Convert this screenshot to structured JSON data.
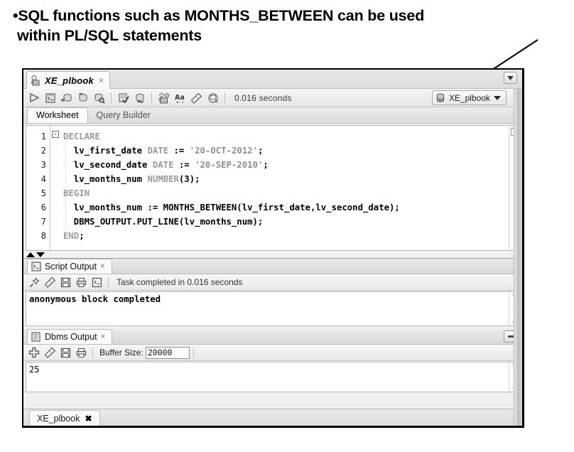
{
  "slide": {
    "bullet_marker": "•",
    "bullet_line1": "SQL functions such as MONTHS_BETWEEN can be used",
    "bullet_line2": "within PL/SQL statements",
    "annotation": "arrow-pointing-to-months-between-call"
  },
  "window": {
    "document_tab": {
      "label": "XE_plbook",
      "close": "×",
      "icon": "sql-worksheet-icon"
    },
    "collapse_button": "chevron-down-icon",
    "toolbar": {
      "buttons": [
        {
          "name": "run-statement-button",
          "icon": "play-triangle-icon"
        },
        {
          "name": "run-script-button",
          "icon": "script-page-icon"
        },
        {
          "name": "explain-plan-button",
          "icon": "explain-plan-icon"
        },
        {
          "name": "autotrace-button",
          "icon": "autotrace-icon"
        },
        {
          "name": "sql-history-button",
          "icon": "db-search-icon"
        },
        {
          "name": "commit-button",
          "icon": "db-check-icon"
        },
        {
          "name": "rollback-button",
          "icon": "db-rollback-icon"
        },
        {
          "name": "unshared-worksheet-button",
          "icon": "sql-new-icon"
        },
        {
          "name": "to-upper-lower-button",
          "icon": "Aa"
        },
        {
          "name": "clear-button",
          "icon": "eraser-icon"
        },
        {
          "name": "query-builder-button",
          "icon": "circle-arrow-icon"
        }
      ],
      "elapsed": "0.016 seconds",
      "connection": {
        "icon": "database-icon",
        "name": "XE_plbook",
        "caret": "chevron-down-icon"
      }
    },
    "worksheet_tabs": [
      {
        "label": "Worksheet",
        "active": true
      },
      {
        "label": "Query Builder",
        "active": false
      }
    ],
    "editor": {
      "line_numbers": [
        "1",
        "2",
        "3",
        "4",
        "5",
        "6",
        "7",
        "8"
      ],
      "fold_marker": "-",
      "lines": [
        [
          {
            "t": "DECLARE",
            "c": "kw"
          }
        ],
        [
          {
            "t": "  lv_first_date ",
            "c": "id"
          },
          {
            "t": "DATE",
            "c": "kw"
          },
          {
            "t": " := ",
            "c": "id"
          },
          {
            "t": "'20-OCT-2012'",
            "c": "str"
          },
          {
            "t": ";",
            "c": "id"
          }
        ],
        [
          {
            "t": "  lv_second_date ",
            "c": "id"
          },
          {
            "t": "DATE",
            "c": "kw"
          },
          {
            "t": " := ",
            "c": "id"
          },
          {
            "t": "'20-SEP-2010'",
            "c": "str"
          },
          {
            "t": ";",
            "c": "id"
          }
        ],
        [
          {
            "t": "  lv_months_num ",
            "c": "id"
          },
          {
            "t": "NUMBER",
            "c": "kw"
          },
          {
            "t": "(3);",
            "c": "id"
          }
        ],
        [
          {
            "t": "BEGIN",
            "c": "kw"
          }
        ],
        [
          {
            "t": "  lv_months_num := MONTHS_BETWEEN(lv_first_date,lv_second_date);",
            "c": "id"
          }
        ],
        [
          {
            "t": "  DBMS_OUTPUT.PUT_LINE(lv_months_num);",
            "c": "id"
          }
        ],
        [
          {
            "t": "END",
            "c": "kw"
          },
          {
            "t": ";",
            "c": "id"
          }
        ]
      ]
    },
    "script_output": {
      "tab": {
        "label": "Script Output",
        "close": "×",
        "icon": "script-output-icon"
      },
      "buttons": [
        {
          "name": "pin-button",
          "icon": "pin-icon"
        },
        {
          "name": "clear-button",
          "icon": "eraser-icon"
        },
        {
          "name": "save-button",
          "icon": "floppy-icon"
        },
        {
          "name": "print-button",
          "icon": "printer-icon"
        },
        {
          "name": "wrap-button",
          "icon": "script-page-icon"
        }
      ],
      "status": "Task completed in 0.016 seconds",
      "text": "anonymous block completed"
    },
    "dbms_output": {
      "tab": {
        "label": "Dbms Output",
        "close": "×",
        "icon": "dbms-output-icon"
      },
      "minimize_button": "minimize-icon",
      "buttons": [
        {
          "name": "enable-dbms-output-button",
          "icon": "plus-icon"
        },
        {
          "name": "clear-button",
          "icon": "eraser-icon"
        },
        {
          "name": "save-button",
          "icon": "floppy-icon"
        },
        {
          "name": "print-button",
          "icon": "printer-icon"
        }
      ],
      "buffer_label": "Buffer Size:",
      "buffer_value": "20000",
      "text": "25"
    },
    "bottom_tab": {
      "label": "XE_plbook",
      "close": "✖"
    },
    "scroll": {
      "up": "⌃",
      "down": "⌄"
    }
  },
  "colors": {
    "window_border": "#000000",
    "chrome": "#f0f0ef",
    "keyword": "#9a9a98",
    "string": "#8f8f8d",
    "identifier": "#000000",
    "editor_bg": "#ffffff"
  }
}
